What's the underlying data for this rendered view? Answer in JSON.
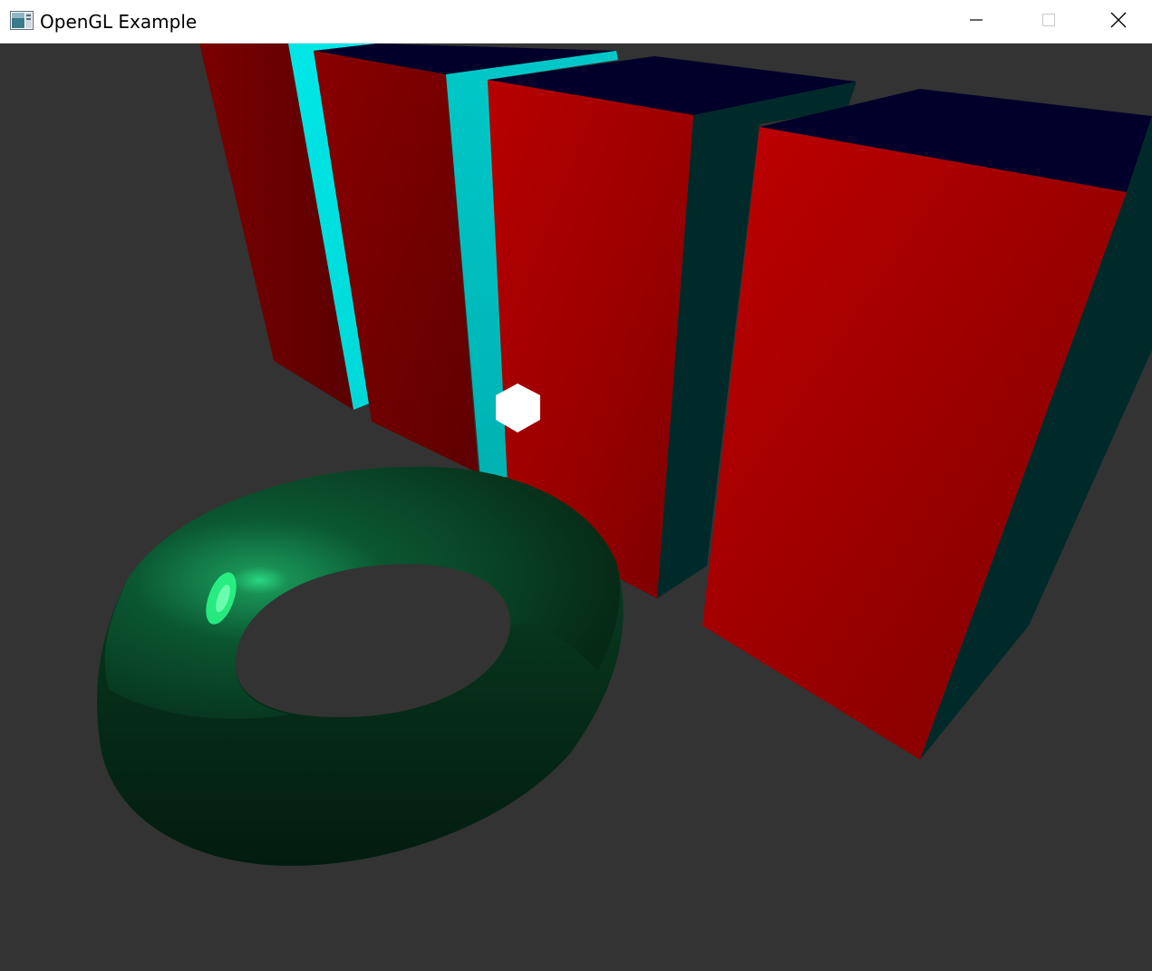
{
  "window": {
    "title": "OpenGL Example",
    "controls": {
      "minimize_icon": "minimize-icon",
      "maximize_icon": "maximize-icon",
      "close_icon": "close-icon"
    }
  },
  "scene": {
    "background_color": "#333333",
    "objects": [
      {
        "name": "red-box",
        "front_color": "#b30000",
        "top_color": "#00002a",
        "side_color": "#002a2a"
      },
      {
        "name": "cyan-slab",
        "color": "#00e0e0"
      },
      {
        "name": "green-torus",
        "color": "#0a5a30",
        "highlight": "#2aff8a"
      },
      {
        "name": "light-marker",
        "color": "#ffffff"
      }
    ]
  }
}
